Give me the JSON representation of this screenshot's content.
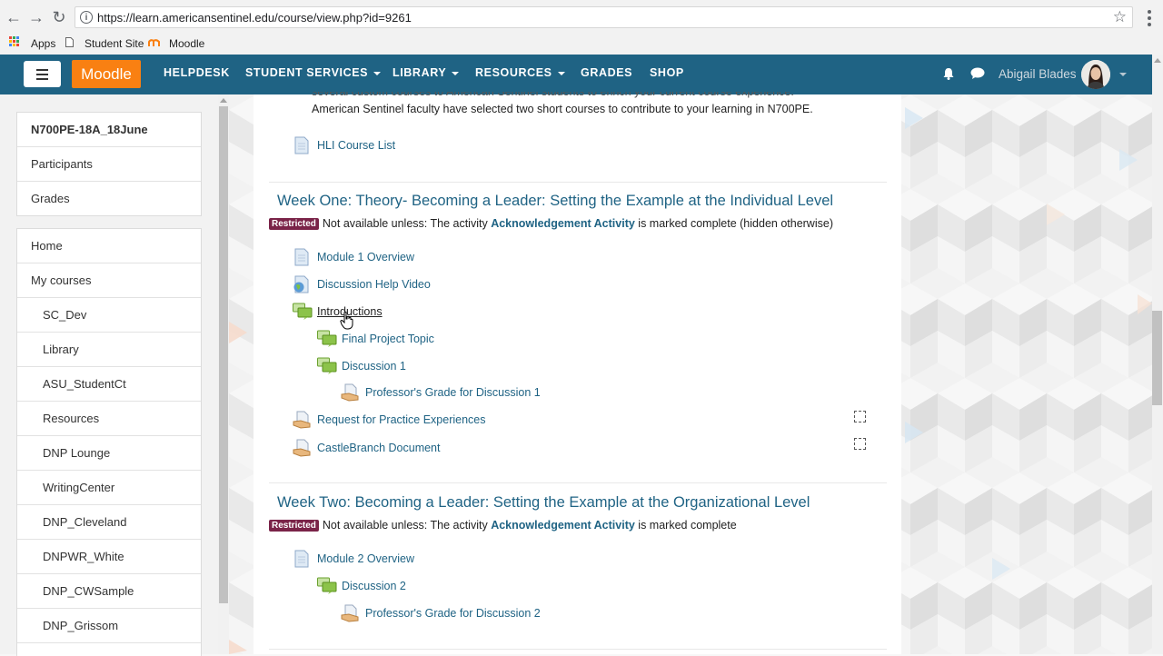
{
  "browser": {
    "url": "https://learn.americansentinel.edu/course/view.php?id=9261",
    "bookmarks": [
      "Apps",
      "Student Site",
      "Moodle"
    ]
  },
  "navbar": {
    "brand": "Moodle",
    "links": [
      "HELPDESK",
      "STUDENT SERVICES",
      "LIBRARY",
      "RESOURCES",
      "GRADES",
      "SHOP"
    ],
    "user_name": "Abigail Blades"
  },
  "drawer": {
    "course_group": [
      "N700PE-18A_18June",
      "Participants",
      "Grades"
    ],
    "site_group": [
      "Home",
      "My courses",
      "SC_Dev",
      "Library",
      "ASU_StudentCt",
      "Resources",
      "DNP Lounge",
      "WritingCenter",
      "DNP_Cleveland",
      "DNPWR_White",
      "DNP_CWSample",
      "DNP_Grissom"
    ]
  },
  "main": {
    "intro_line_1": "several custom courses to American Sentinel students to enrich your current course experience.",
    "intro_line_2": "American Sentinel faculty have selected two short courses to contribute to your learning in N700PE.",
    "hli_link": "HLI Course List",
    "week1": {
      "title": "Week One: Theory- Becoming a Leader: Setting the Example at the Individual Level",
      "badge": "Restricted",
      "restr_prefix": "Not available unless: The activity",
      "restr_activity": "Acknowledgement Activity",
      "restr_suffix": "is marked complete (hidden otherwise)",
      "activities": [
        "Module 1 Overview",
        "Discussion Help Video",
        "Introductions",
        "Final Project Topic",
        "Discussion 1",
        "Professor's Grade for Discussion 1",
        "Request for Practice Experiences",
        "CastleBranch Document"
      ]
    },
    "week2": {
      "title": "Week Two: Becoming a Leader: Setting the Example at the Organizational Level",
      "badge": "Restricted",
      "restr_prefix": "Not available unless: The activity",
      "restr_activity": "Acknowledgement Activity",
      "restr_suffix": "is marked complete",
      "activities": [
        "Module 2 Overview",
        "Discussion 2",
        "Professor's Grade for Discussion 2"
      ]
    }
  },
  "colors": {
    "navbar": "#1f6384",
    "brand": "#f98012",
    "link": "#1f6384",
    "badge": "#7a2348"
  }
}
